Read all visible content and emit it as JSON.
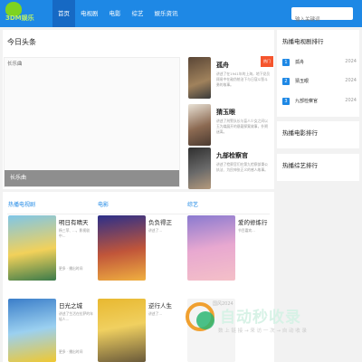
{
  "nav": {
    "logo_text": "3DM娱乐",
    "items": [
      {
        "label": "首页",
        "active": true
      },
      {
        "label": "电视剧"
      },
      {
        "label": "电影"
      },
      {
        "label": "综艺"
      },
      {
        "label": "娱乐资讯"
      }
    ],
    "search_placeholder": "输入关键词"
  },
  "headline": {
    "title": "今日头条",
    "hero_alt": "长乐曲",
    "hero_caption": "长乐曲",
    "features": [
      {
        "title": "孤舟",
        "desc": "讲述了在1941年的上海，地下党员顾易中在敌伪统治下与日寇斗智斗勇的故事。"
      },
      {
        "title": "猜玉眼",
        "desc": "讲述了刑警队长与盲人少女之间以玉为媒展开的悬疑探案故事，扑朔迷离。"
      },
      {
        "title": "九部检察官",
        "desc": "讲述了检察官们在第九检察部秉公执法、为民伸张正义的感人故事。"
      }
    ],
    "ribbon": "热门"
  },
  "sidebar": {
    "tv_rank": {
      "title": "热播电视剧排行",
      "items": [
        {
          "num": "1",
          "name": "孤舟",
          "year": "2024"
        },
        {
          "num": "2",
          "name": "猜玉眼",
          "year": "2024"
        },
        {
          "num": "3",
          "name": "九部检察官",
          "year": "2024"
        }
      ]
    },
    "movie_rank_title": "热播电影排行",
    "variety_rank_title": "热播综艺排行"
  },
  "grid": {
    "columns": [
      {
        "heading": "热播电视剧",
        "items": [
          {
            "title": "明日有晴天",
            "desc": "杨三菲、...，影视剧中...",
            "meta": "更多 · 播出时间"
          },
          {
            "title": "日光之城",
            "desc": "讲述了生活在拉萨的年轻人...",
            "meta": "更多 · 播出时间"
          }
        ]
      },
      {
        "heading": "电影",
        "items": [
          {
            "title": "负负得正",
            "desc": "讲述了..."
          },
          {
            "title": "逆行人生",
            "desc": "讲述了..."
          }
        ]
      },
      {
        "heading": "综艺",
        "items": [
          {
            "title": "爱的修炼行",
            "desc": "节目嘉宾..."
          },
          {
            "title": "",
            "desc": "",
            "year_label": "国风2024"
          }
        ]
      }
    ]
  },
  "watermark": {
    "title": "自动秒收录",
    "sub": "数 上 链 接 → 来 访 一 次 → 自 动 收 录"
  },
  "colors": {
    "nav_bg": "#1e88e5",
    "accent": "#1e88e5"
  }
}
